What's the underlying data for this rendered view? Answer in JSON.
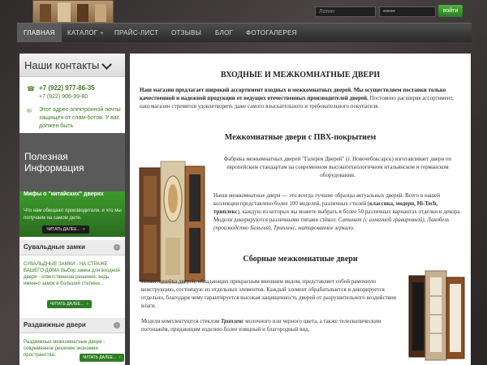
{
  "header": {
    "login_placeholder": "Логин",
    "password_value": "••••••",
    "enter_label": "войти"
  },
  "nav": {
    "items": [
      "ГЛАВНАЯ",
      "КАТАЛОГ",
      "ПРАЙС-ЛИСТ",
      "ОТЗЫВЫ",
      "БЛОГ",
      "ФОТОГАЛЕРЕЯ"
    ],
    "catalog_arrow": "+"
  },
  "sidebar": {
    "contacts_title": "Наши контакты",
    "phone1": "+7 (922) 977-86-35",
    "phone2": "+7 (922) 906-99-80",
    "email_text": "Этот адрес электронной почты защищен от спам-ботов. У вас должен быть",
    "useful_title": "Полезная Информация",
    "myths_title": "Мифы о \"китайских\" дверях",
    "myths_text": "Что нам обещают производители, и что мы получаем на самом деле.",
    "read_more": "ЧИТАТЬ ДАЛЕЕ...",
    "locks_title": "Сувальдные замки",
    "locks_text": "СУВАЛЬДНЫЕ ЗАМКИ - НА СТРАЖЕ ВАШЕГО ДОМА   Выбор замка для входной двери - ответственное решение, ведь именно замок в большей степени...",
    "sliding_title": "Раздвижные двери",
    "sliding_text": "Раздвижные межкомнатные двери - современное решение экономии пространства."
  },
  "main": {
    "h1": "ВХОДНЫЕ И МЕЖКОМНАТНЫЕ ДВЕРИ",
    "p1_bold": "Наш магазин предлагает широкий ассортимент входных и межкомнатных дверей. Мы осуществляем поставки только качественной и надежной продукции от ведущих отечественных производителей дверей.",
    "p1_rest": " Постоянно расширяя ассортимент, наш магазин стремится удовлетворить даже самого взыскательного и требовательного покупателя.",
    "h2": "Межкомнатные двери с ПВХ-покрытием",
    "p2": "Фабрика межкомнатных дверей \"Галерея Дверей\" (г. Новочебоксарск) изготавливает двери по европейским стандартам на современном высокотехнологичном итальянском и германском оборудовании.",
    "p3_a": "Наши межкомнатные двери — это всегда лучшие образцы актуальных дверей. Всего в нашей коллекции представлено более 100 моделей, различных стилей (",
    "p3_b": "классика, модерн, Hi-Tech, триплекс",
    "p3_c": "), каждую из которых вы можете выбрать в более 50 различных вариантах отделки и декора. Модели декорируются различными типами стёкол: ",
    "p3_d": "Сатинат (с алмазной гравировкой), Лакобель (производство Бельгия), Триплекс, матированное зеркало.",
    "h3": "Сборные межкомнатные двери",
    "p4": "Новая линейка дверей, обладающих прекрасным внешним видом, представляет собой рамочную конструкцию, состоящую из отдельных элементов. Каждый элемент обрабатывается и декорируется отдельно, благодаря чему гарантируется высокая защищенность дверей от разрушительного воздействия влаги.",
    "p5_a": "Модели комплектуются стеклом ",
    "p5_b": "Триплекс",
    "p5_c": " молочного или черного цвета, а также телескопическим погонажём, придающим изделию более изящный и благородный вид."
  },
  "colors": {
    "accent_green": "#3d9a2d",
    "nav_bg": "#3a3a3a"
  }
}
